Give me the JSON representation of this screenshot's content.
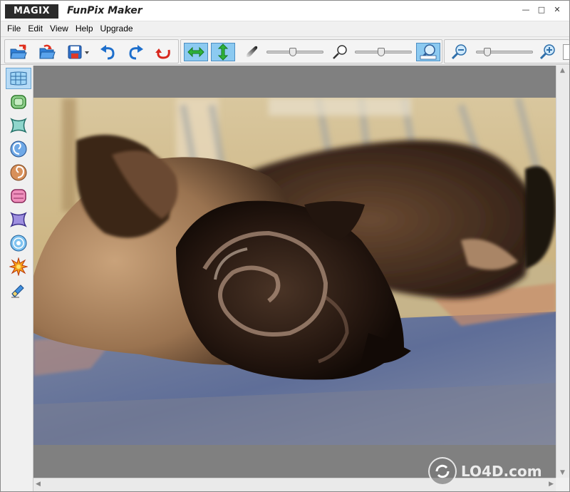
{
  "window": {
    "logo_text": "MAGIX",
    "title": "FunPix Maker",
    "minimize": "—",
    "maximize": "□",
    "close": "✕"
  },
  "menu": {
    "items": [
      "File",
      "Edit",
      "View",
      "Help",
      "Upgrade"
    ]
  },
  "toolbar": {
    "file_buttons": [
      "open-file-icon",
      "open-recent-icon",
      "save-icon"
    ],
    "history_buttons": [
      "undo-icon",
      "redo-icon",
      "reset-icon"
    ],
    "view_buttons": [
      "fit-width-icon",
      "fit-height-icon"
    ],
    "brush_slider_value": 0.45,
    "strength_slider_value": 0.45,
    "zoom_slider_value": 0.15,
    "accent": "#1e90e0"
  },
  "tools": {
    "items": [
      {
        "name": "grid-warp-tool-icon",
        "active": true
      },
      {
        "name": "bulge-tool-icon",
        "active": false
      },
      {
        "name": "pinch-tool-icon",
        "active": false
      },
      {
        "name": "twirl-left-tool-icon",
        "active": false
      },
      {
        "name": "twirl-right-tool-icon",
        "active": false
      },
      {
        "name": "bloat-tool-icon",
        "active": false
      },
      {
        "name": "shrink-tool-icon",
        "active": false
      },
      {
        "name": "ripple-tool-icon",
        "active": false
      },
      {
        "name": "explode-tool-icon",
        "active": false
      },
      {
        "name": "eraser-tool-icon",
        "active": false
      }
    ]
  },
  "watermark": {
    "text": "LO4D.com"
  }
}
